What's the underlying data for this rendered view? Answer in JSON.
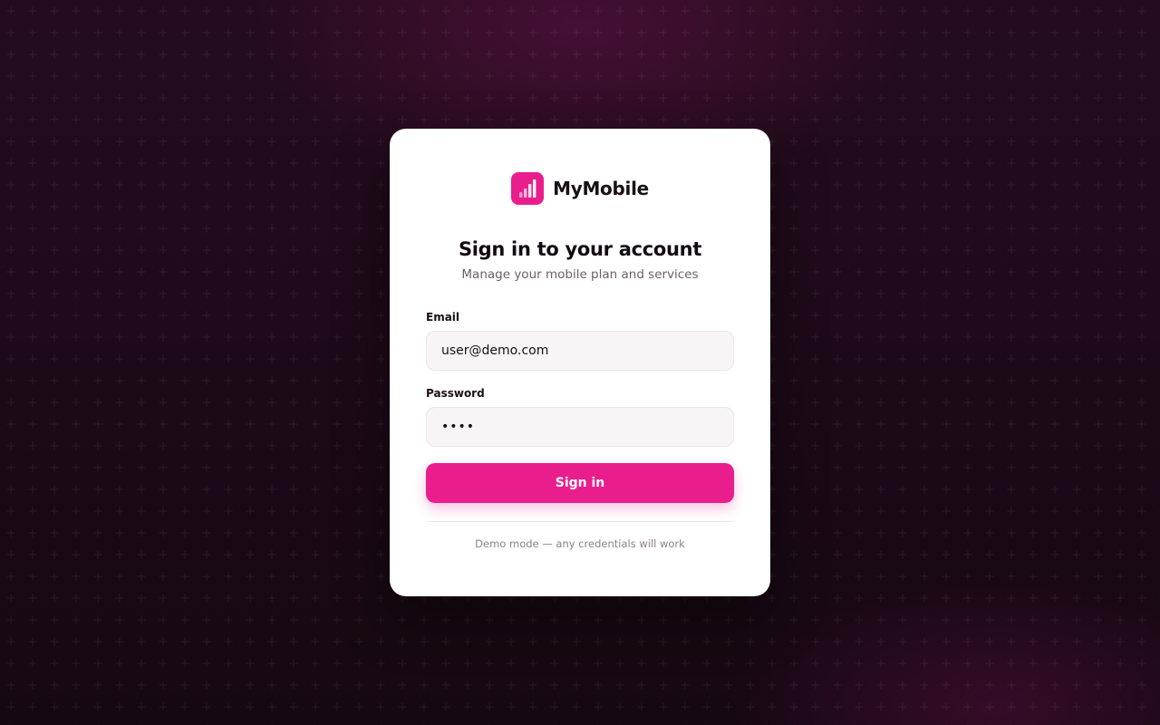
{
  "brand": {
    "name": "MyMobile",
    "logo_icon": "signal-bars-icon",
    "accent_color": "#e91e8c"
  },
  "login": {
    "title": "Sign in to your account",
    "subtitle": "Manage your mobile plan and services",
    "email": {
      "label": "Email",
      "value": "user@demo.com"
    },
    "password": {
      "label": "Password",
      "value": "demo"
    },
    "submit_label": "Sign in",
    "footnote": "Demo mode — any credentials will work"
  }
}
